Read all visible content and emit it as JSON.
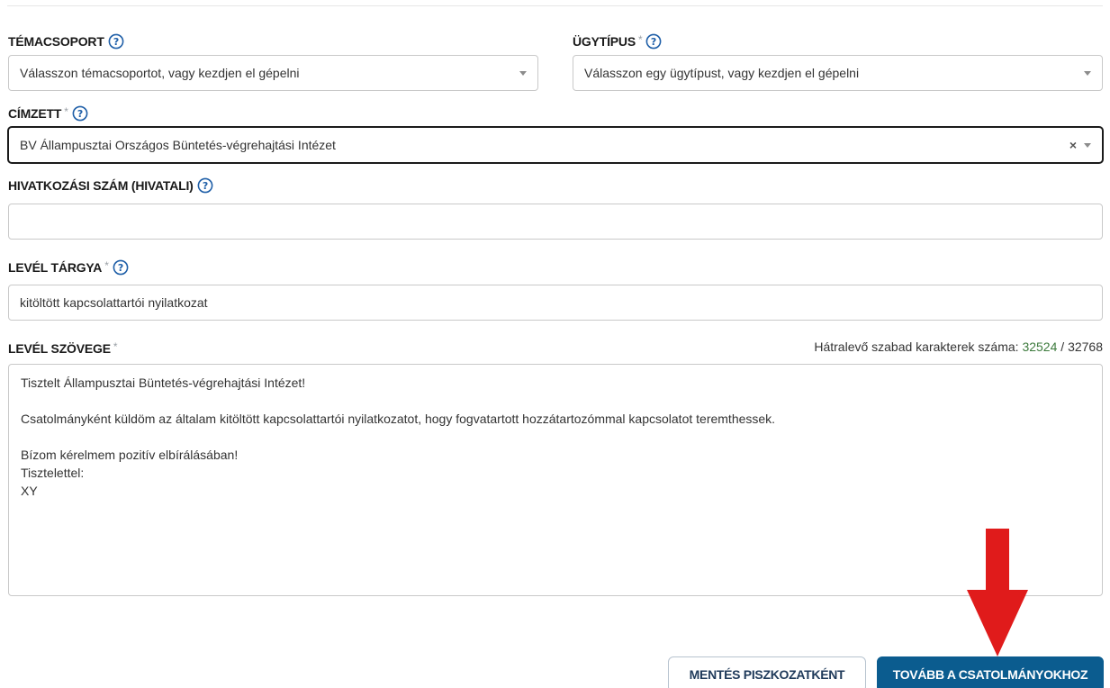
{
  "form": {
    "topic": {
      "label": "TÉMACSOPORT",
      "required": false,
      "placeholder": "Válasszon témacsoportot, vagy kezdjen el gépelni"
    },
    "case_type": {
      "label": "ÜGYTÍPUS",
      "required": true,
      "placeholder": "Válasszon egy ügytípust, vagy kezdjen el gépelni"
    },
    "recipient": {
      "label": "CÍMZETT",
      "required": true,
      "value": "BV Állampusztai Országos Büntetés-végrehajtási Intézet",
      "clear_glyph": "×"
    },
    "reference_number": {
      "label": "HIVATKOZÁSI SZÁM (HIVATALI)",
      "value": ""
    },
    "subject": {
      "label": "LEVÉL TÁRGYA",
      "required": true,
      "value": "kitöltött kapcsolattartói nyilatkozat"
    },
    "body": {
      "label": "LEVÉL SZÖVEGE",
      "required": true,
      "counter_label": "Hátralevő szabad karakterek száma:",
      "remaining": "32524",
      "separator": "/",
      "max": "32768",
      "lines": [
        "Tisztelt Állampusztai Büntetés-végrehajtási Intézet!",
        "",
        "Csatolmányként küldöm az általam kitöltött kapcsolattartói nyilatkozatot, hogy fogvatartott hozzátartozómmal kapcsolatot teremthessek.",
        "",
        "Bízom kérelmem pozitív elbírálásában!",
        "Tisztelettel:",
        "XY"
      ]
    },
    "required_marker": "*"
  },
  "actions": {
    "save_draft": "MENTÉS PISZKOZATKÉNT",
    "next": "TOVÁBB A CSATOLMÁNYOKHOZ"
  },
  "colors": {
    "primary": "#0b5c8f",
    "help_icon": "#1f5fa8",
    "arrow": "#e01b1b",
    "remaining_count": "#3c7a3c"
  },
  "icons": {
    "help": "question-circle-icon",
    "dropdown": "caret-down-icon",
    "clear": "close-icon",
    "annotation": "red-down-arrow"
  }
}
